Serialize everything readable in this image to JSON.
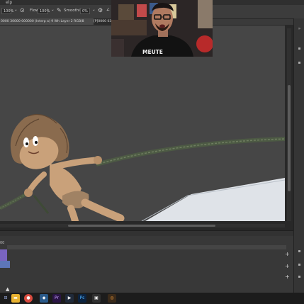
{
  "menu": {
    "items": [
      "elp"
    ]
  },
  "options": {
    "fields": [
      {
        "label": "",
        "value": "100%"
      },
      {
        "label": "Flow:",
        "value": "100%"
      },
      {
        "label": "Smoothing:",
        "value": "0%"
      }
    ]
  },
  "document": {
    "tab_title": "0000 30000 000000 (Interp a) 9 Wh Layer 2 RGB/8",
    "tab_title_2": "[P]0000 03.",
    "timeline_label": "00"
  },
  "webcam": {
    "shirt_text": "MEUTE"
  },
  "taskbar": {
    "icons": [
      {
        "name": "windows-start-icon",
        "glyph": "⊞",
        "color": "#1c1c1c"
      },
      {
        "name": "file-explorer-icon",
        "glyph": "▬",
        "color": "#e8b230"
      },
      {
        "name": "chrome-icon",
        "glyph": "●",
        "color": "#d94b3f"
      },
      {
        "name": "steam-icon",
        "glyph": "◆",
        "color": "#2a5a8a"
      },
      {
        "name": "premiere-icon",
        "glyph": "Pr",
        "color": "#2a1545"
      },
      {
        "name": "media-icon",
        "glyph": "▶",
        "color": "#202a3a"
      },
      {
        "name": "photoshop-icon",
        "glyph": "Ps",
        "color": "#0c2340"
      },
      {
        "name": "terminal-icon",
        "glyph": "▣",
        "color": "#303030"
      },
      {
        "name": "blender-icon",
        "glyph": "◎",
        "color": "#3a2a1a"
      }
    ]
  },
  "colors": {
    "canvas_bg": "#464646",
    "sky": "#dfe3e8",
    "rope": "#4d5a44",
    "skin": "#c9a17a",
    "hair": "#8a6b4e"
  }
}
